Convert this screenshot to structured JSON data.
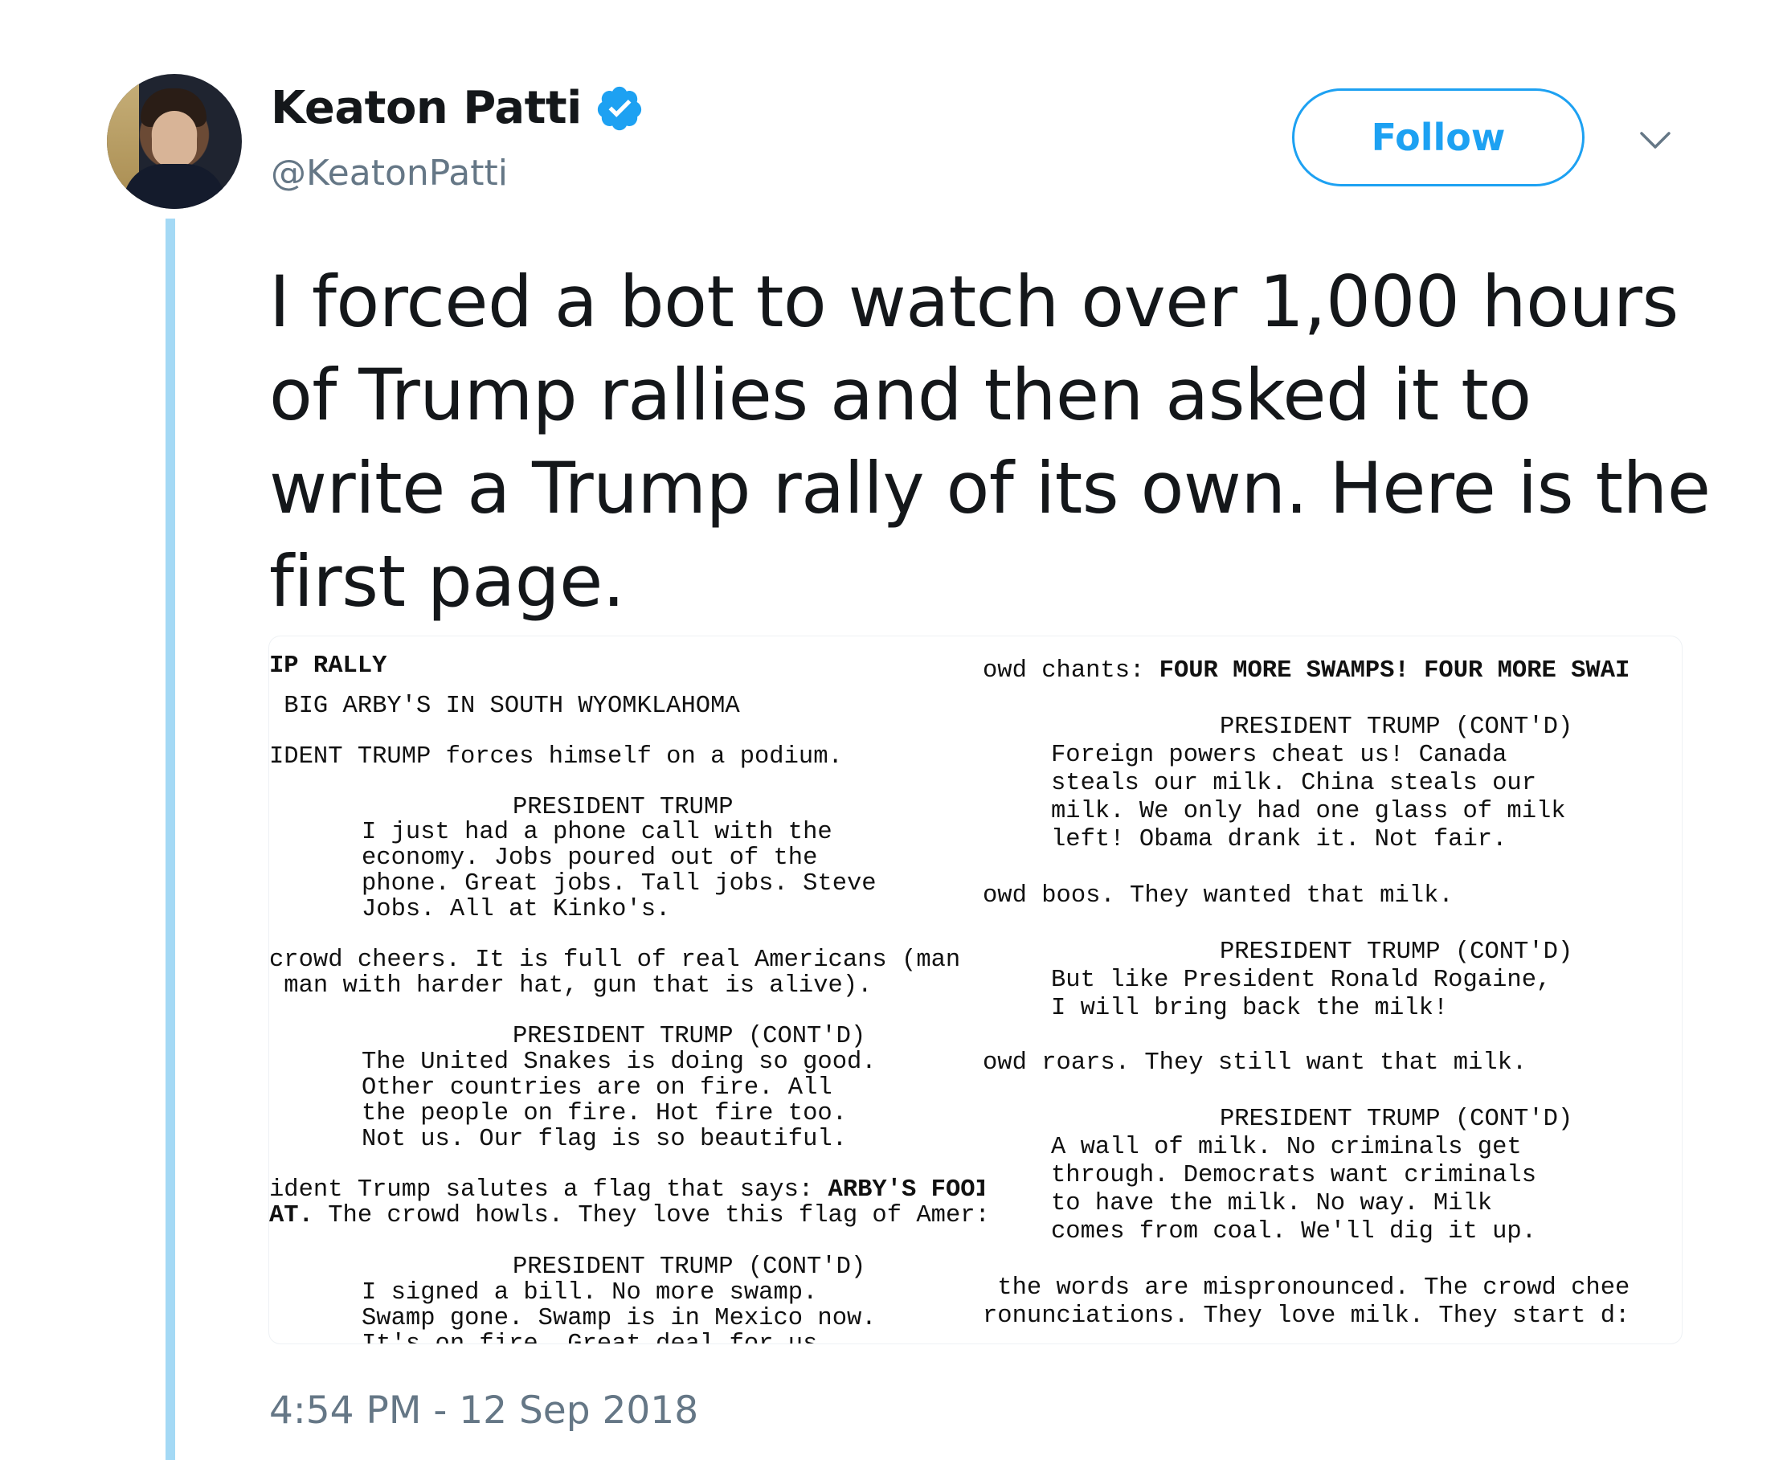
{
  "author": {
    "name": "Keaton Patti",
    "handle": "@KeatonPatti",
    "verified": true
  },
  "follow_label": "Follow",
  "tweet": {
    "text": "I forced a bot to watch over 1,000 hours of Trump rallies and then asked it to write a Trump rally of its own. Here is the first page.",
    "timestamp": "4:54 PM - 12 Sep 2018"
  },
  "script_left": [
    "IP RALLY",
    " BIG ARBY'S IN SOUTH WYOMKLAHOMA",
    "IDENT TRUMP forces himself on a podium.",
    "PRESIDENT TRUMP",
    "I just had a phone call with the",
    "economy. Jobs poured out of the",
    "phone. Great jobs. Tall jobs. Steve",
    "Jobs. All at Kinko's.",
    "crowd cheers. It is full of real Americans (man ",
    " man with harder hat, gun that is alive).",
    "PRESIDENT TRUMP (CONT'D)",
    "The United Snakes is doing so good.",
    "Other countries are on fire. All",
    "the people on fire. Hot fire too.",
    "Not us. Our flag is so beautiful.",
    "ident Trump salutes a flag that says: ",
    "ARBY'S FOOI",
    "AT.",
    " The crowd howls. They love this flag of Amer:",
    "PRESIDENT TRUMP (CONT'D)",
    "I signed a bill. No more swamp.",
    "Swamp gone. Swamp is in Mexico now.",
    "It's on fire. Great deal for us."
  ],
  "script_right": [
    "owd chants: ",
    "FOUR MORE SWAMPS! FOUR MORE SWAI",
    "PRESIDENT TRUMP (CONT'D)",
    "Foreign powers cheat us! Canada",
    "steals our milk. China steals our",
    "milk. We only had one glass of milk",
    "left! Obama drank it. Not fair.",
    "owd boos. They wanted that milk.",
    "PRESIDENT TRUMP (CONT'D)",
    "But like President Ronald Rogaine,",
    "I will bring back the milk!",
    "owd roars. They still want that milk.",
    "PRESIDENT TRUMP (CONT'D)",
    "A wall of milk. No criminals get",
    "through. Democrats want criminals",
    "to have the milk. No way. Milk",
    "comes from coal. We'll dig it up.",
    " the words are mispronounced. The crowd chee",
    "ronunciations. They love milk. They start d:"
  ],
  "icons": {
    "verified": "verified-badge-icon",
    "chevron": "chevron-down-icon"
  },
  "colors": {
    "accent": "#1da1f2",
    "secondary_text": "#657786",
    "thread_line": "#a4d9f5"
  }
}
